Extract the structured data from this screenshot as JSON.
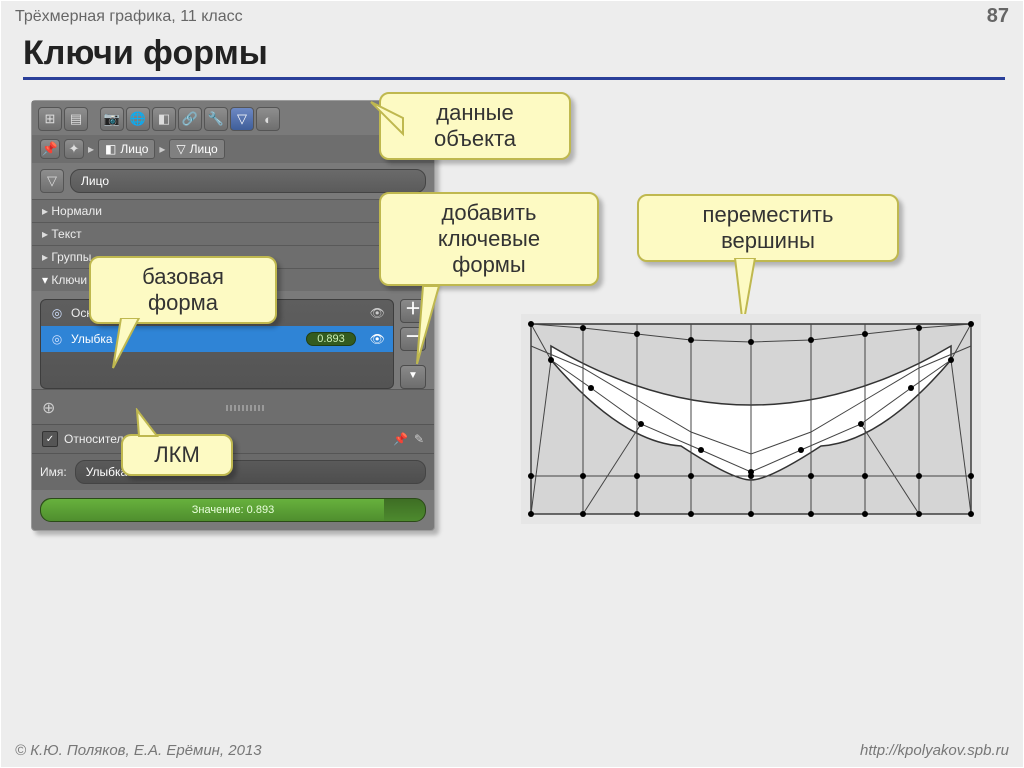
{
  "header": {
    "course": "Трёхмерная графика, 11 класс",
    "page": "87"
  },
  "title": "Ключи формы",
  "panel": {
    "breadcrumb": {
      "scene": "Лицо",
      "object": "Лицо"
    },
    "mesh_name": "Лицо",
    "sections": {
      "normals": "Нормали",
      "texture": "Текст",
      "groups": "Группы",
      "shapekeys": "Ключи формы"
    },
    "keys": [
      {
        "name": "Основа",
        "value": null
      },
      {
        "name": "Улыбка",
        "value": "0.893"
      }
    ],
    "relative": "Относительно",
    "name_label": "Имя:",
    "name_value": "Улыбка",
    "slider_label": "Значение: 0.893"
  },
  "callouts": {
    "object_data": "данные\nобъекта",
    "add_shape": "добавить\nключевые\nформы",
    "base_shape": "базовая\nформа",
    "lmb": "ЛКМ",
    "move_verts": "переместить\nвершины"
  },
  "footer": {
    "copyright": "© К.Ю. Поляков, Е.А. Ерёмин, 2013",
    "url": "http://kpolyakov.spb.ru"
  }
}
